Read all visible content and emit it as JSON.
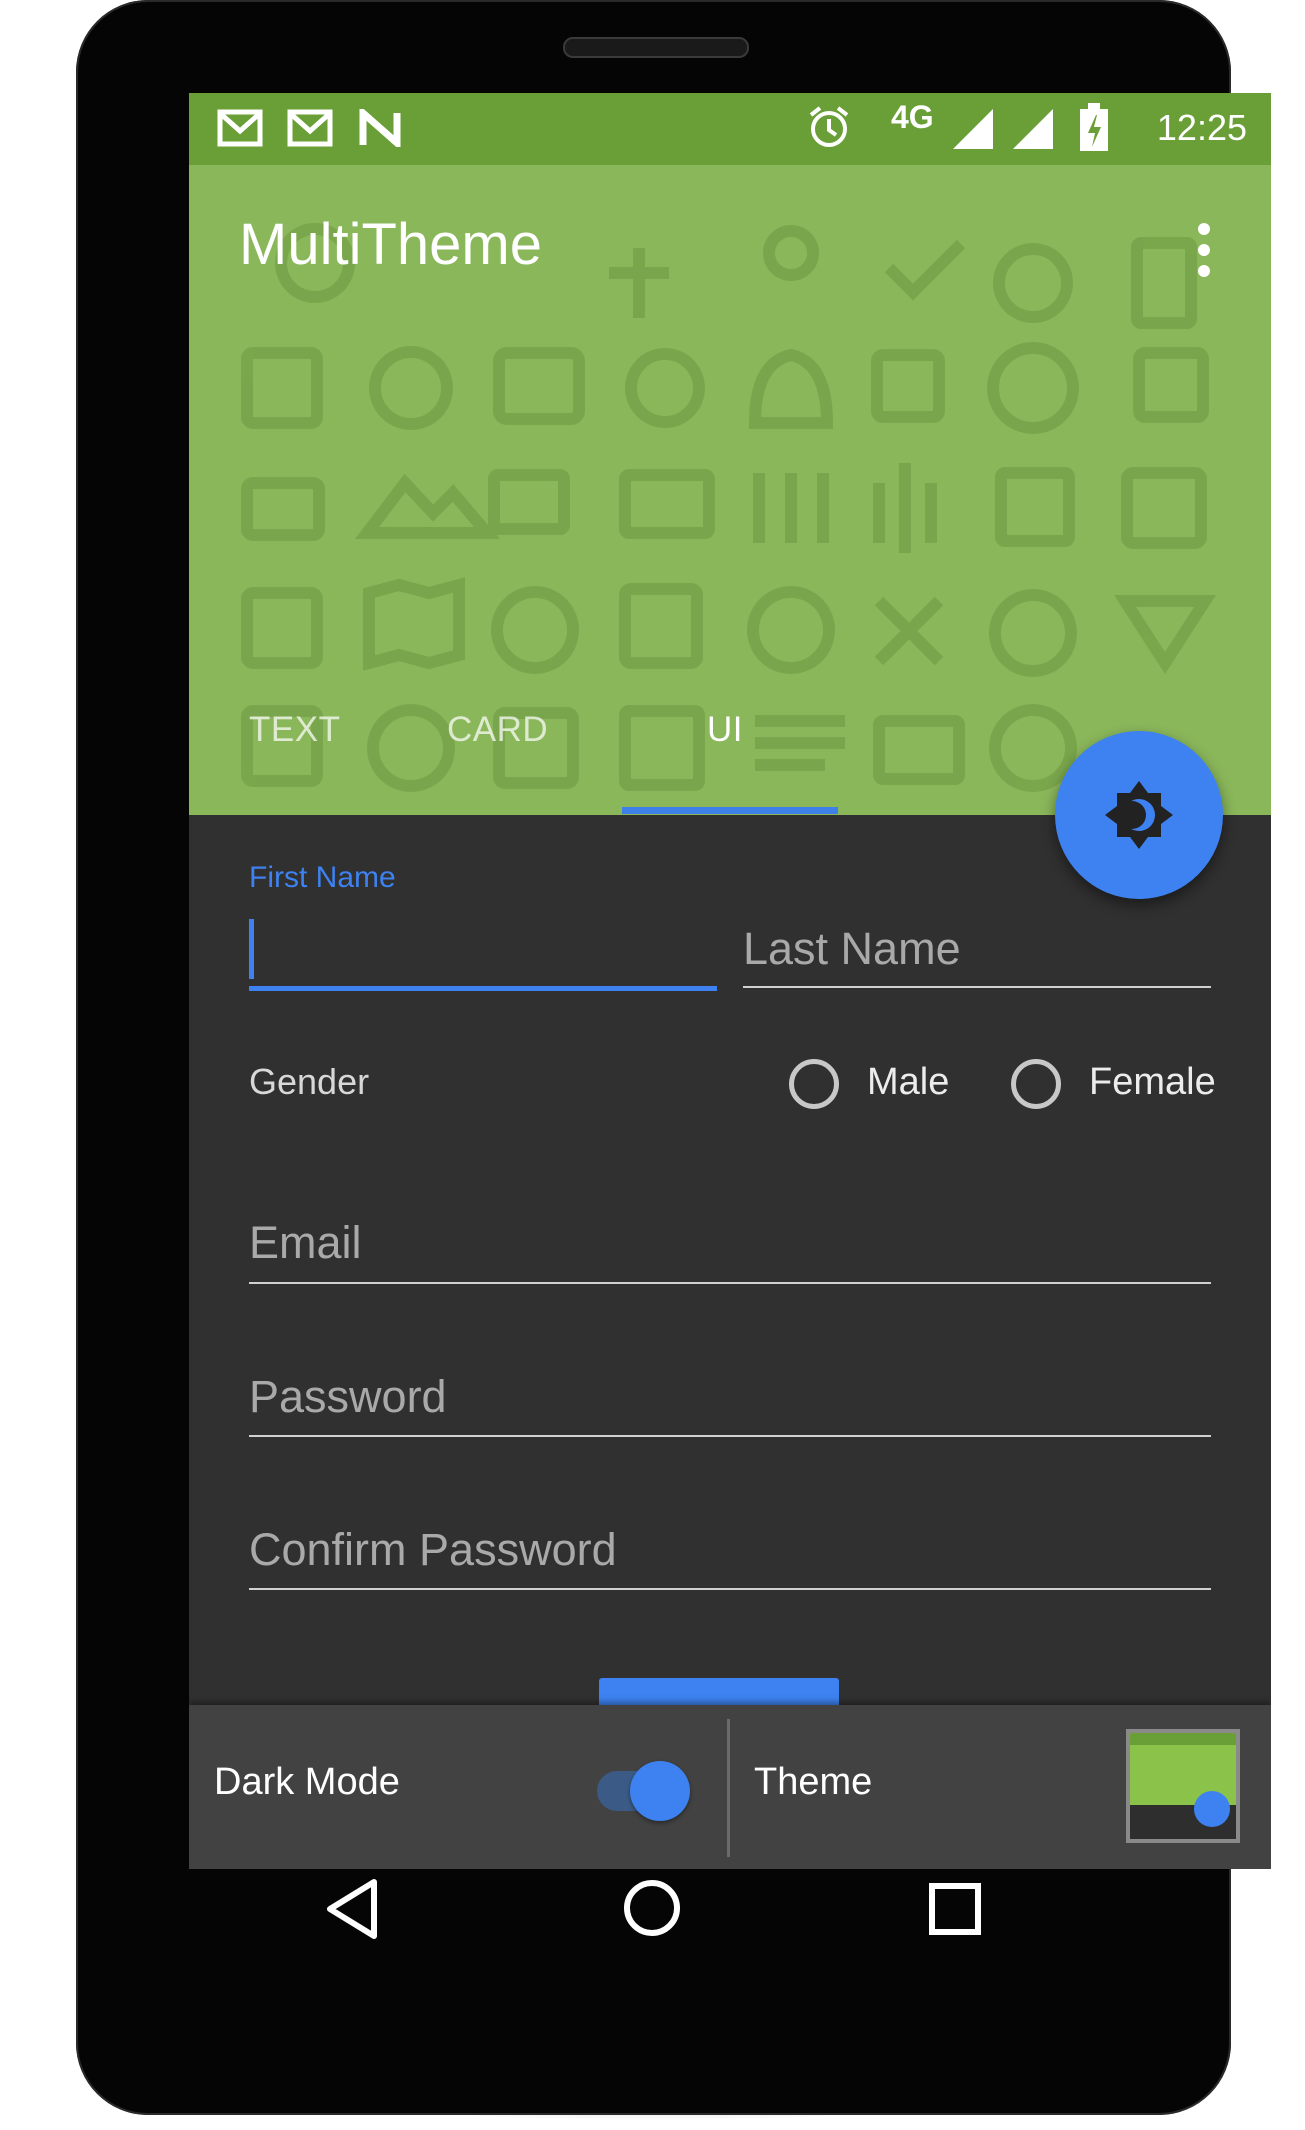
{
  "status_bar": {
    "time": "12:25",
    "network": "4G",
    "icons": [
      "gmail-icon",
      "gmail-icon",
      "n-notification-icon",
      "alarm-icon",
      "signal-icon",
      "signal-icon",
      "battery-charging-icon"
    ]
  },
  "toolbar": {
    "title": "MultiTheme",
    "overflow_icon": "more-vert-icon"
  },
  "tabs": [
    {
      "label": "TEXT",
      "active": false
    },
    {
      "label": "CARD",
      "active": false
    },
    {
      "label": "UI",
      "active": true
    }
  ],
  "fab": {
    "icon": "brightness-icon"
  },
  "form": {
    "first_name": {
      "label": "First Name",
      "value": ""
    },
    "last_name": {
      "placeholder": "Last Name",
      "value": ""
    },
    "gender": {
      "label": "Gender",
      "options": [
        {
          "label": "Male",
          "selected": false
        },
        {
          "label": "Female",
          "selected": false
        }
      ]
    },
    "email": {
      "placeholder": "Email",
      "value": ""
    },
    "password": {
      "placeholder": "Password",
      "value": ""
    },
    "confirm_password": {
      "placeholder": "Confirm Password",
      "value": ""
    }
  },
  "bottom_panel": {
    "dark_mode": {
      "label": "Dark Mode",
      "enabled": true
    },
    "theme": {
      "label": "Theme"
    }
  },
  "colors": {
    "primary": "#8bb75b",
    "primary_dark": "#699f36",
    "accent": "#3d82f0",
    "background": "#303030",
    "panel": "#424242"
  },
  "nav_bar": [
    "back-icon",
    "home-icon",
    "recents-icon"
  ]
}
